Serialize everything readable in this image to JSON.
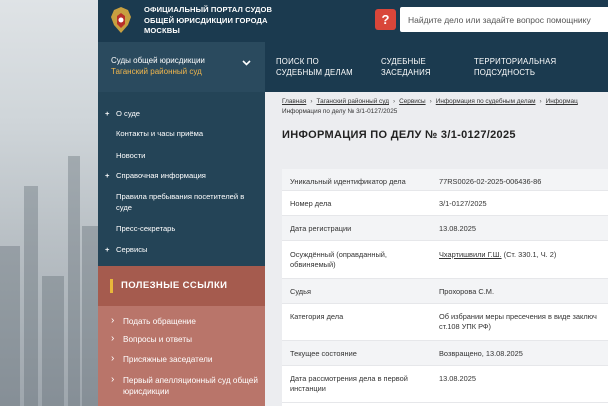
{
  "header": {
    "portal_title": "ОФИЦИАЛЬНЫЙ ПОРТАЛ СУДОВ ОБЩЕЙ ЮРИСДИКЦИИ ГОРОДА МОСКВЫ",
    "help_label": "?",
    "search_placeholder": "Найдите дело или задайте вопрос помощнику"
  },
  "court_selector": {
    "name": "Суды общей юрисдикции",
    "subname": "Таганский районный суд"
  },
  "topnav": [
    {
      "label": "ПОИСК ПО СУДЕБНЫМ ДЕЛАМ"
    },
    {
      "label": "СУДЕБНЫЕ ЗАСЕДАНИЯ"
    },
    {
      "label": "ТЕРРИТОРИАЛЬНАЯ ПОДСУДНОСТЬ"
    }
  ],
  "sidebar": {
    "items": [
      {
        "label": "О суде"
      },
      {
        "label": "Контакты и часы приёма"
      },
      {
        "label": "Новости"
      },
      {
        "label": "Справочная информация"
      },
      {
        "label": "Правила пребывания посетителей в суде"
      },
      {
        "label": "Пресс-секретарь"
      },
      {
        "label": "Сервисы"
      }
    ]
  },
  "useful_links": {
    "title": "ПОЛЕЗНЫЕ ССЫЛКИ",
    "items": [
      {
        "label": "Подать обращение"
      },
      {
        "label": "Вопросы и ответы"
      },
      {
        "label": "Присяжные заседатели"
      },
      {
        "label": "Первый апелляционный суд общей юрисдикции"
      }
    ]
  },
  "breadcrumbs": [
    {
      "label": "Главная"
    },
    {
      "label": "Таганский районный суд"
    },
    {
      "label": "Сервисы"
    },
    {
      "label": "Информация по судебным делам"
    },
    {
      "label": "Информац"
    }
  ],
  "breadcrumb_current": "Информация по делу № 3/1-0127/2025",
  "page_title": "ИНФОРМАЦИЯ ПО ДЕЛУ № 3/1-0127/2025",
  "case_table": [
    {
      "key": "Уникальный идентификатор дела",
      "value": "77RS0026-02-2025-006436-86"
    },
    {
      "key": "Номер дела",
      "value": "3/1-0127/2025"
    },
    {
      "key": "Дата регистрации",
      "value": "13.08.2025"
    },
    {
      "key": "Осуждённый (оправданный, обвиняемый)",
      "value_link": "Чхартишвили Г.Ш.",
      "value_rest": " (Ст. 330.1, Ч. 2)"
    },
    {
      "key": "Судья",
      "value": "Прохорова С.М."
    },
    {
      "key": "Категория дела",
      "value": "Об избрании меры пресечения в виде заключ",
      "value2": "ст.108 УПК РФ)"
    },
    {
      "key": "Текущее состояние",
      "value": "Возвращено, 13.08.2025"
    },
    {
      "key": "Дата рассмотрения дела в первой инстанции",
      "value": "13.08.2025"
    }
  ]
}
